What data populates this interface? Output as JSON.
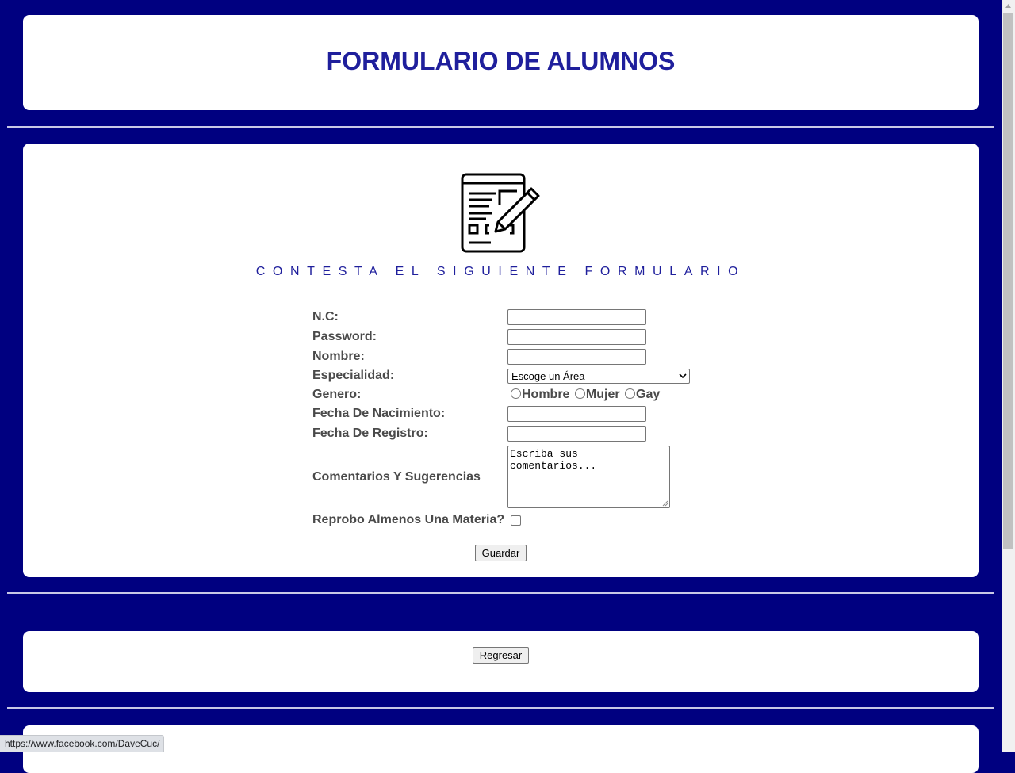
{
  "header": {
    "title": "FORMULARIO DE ALUMNOS"
  },
  "form": {
    "subtitle": "CONTESTA EL SIGUIENTE FORMULARIO",
    "icon": "form-with-pencil-icon",
    "fields": {
      "nc_label": "N.C:",
      "password_label": "Password:",
      "nombre_label": "Nombre:",
      "especialidad_label": "Especialidad:",
      "especialidad_value": "Escoge un Área",
      "genero_label": "Genero:",
      "genero_options": [
        "Hombre",
        "Mujer",
        "Gay"
      ],
      "fecha_nacimiento_label": "Fecha De Nacimiento:",
      "fecha_registro_label": "Fecha De Registro:",
      "comentarios_label": "Comentarios Y Sugerencias",
      "comentarios_value": "Escriba sus comentarios...",
      "reprobo_label": "Reprobo Almenos Una Materia?"
    },
    "save_label": "Guardar"
  },
  "navigation": {
    "back_label": "Regresar"
  },
  "status_bar": {
    "url": "https://www.facebook.com/DaveCuc/"
  },
  "colors": {
    "background": "#000080",
    "title": "#1f1f9c",
    "label": "#4a4a4a",
    "card": "#ffffff"
  }
}
